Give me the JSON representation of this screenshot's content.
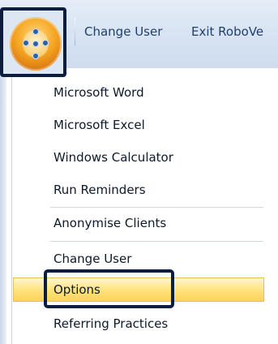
{
  "toolbar": {
    "change_user": "Change User",
    "exit": "Exit RoboVe"
  },
  "app_button": {
    "icon": "application-orb-icon"
  },
  "menu": {
    "items": [
      {
        "label": "Microsoft Word"
      },
      {
        "label": "Microsoft Excel"
      },
      {
        "label": "Windows Calculator"
      },
      {
        "label": "Run Reminders"
      },
      {
        "label": "Anonymise Clients"
      },
      {
        "label": "Change User"
      },
      {
        "label": "Options",
        "state": "highlighted"
      },
      {
        "label": "Referring Practices"
      }
    ]
  },
  "colors": {
    "highlight": "#ffe27a",
    "frame": "#0c1c3e",
    "orb": "#f5a623",
    "toolbar_text": "#1f3f6e"
  }
}
